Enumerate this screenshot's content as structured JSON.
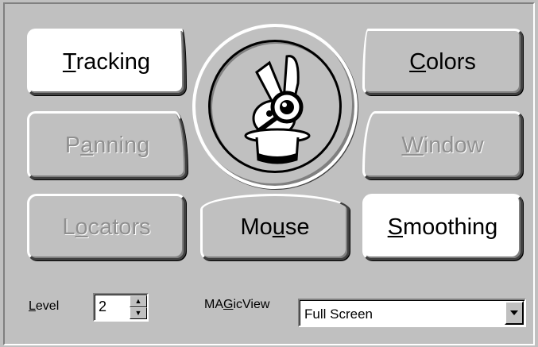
{
  "buttons": {
    "tracking": {
      "pre": "",
      "key": "T",
      "post": "racking"
    },
    "colors": {
      "pre": "",
      "key": "C",
      "post": "olors"
    },
    "panning": {
      "pre": "P",
      "key": "a",
      "post": "nning"
    },
    "window": {
      "pre": "",
      "key": "W",
      "post": "indow"
    },
    "locators": {
      "pre": "L",
      "key": "o",
      "post": "cators"
    },
    "mouse": {
      "pre": "Mo",
      "key": "u",
      "post": "se"
    },
    "smoothing": {
      "pre": "",
      "key": "S",
      "post": "moothing"
    }
  },
  "level": {
    "pre": "",
    "key": "L",
    "post": "evel",
    "value": "2"
  },
  "magicview": {
    "pre": "MA",
    "key": "G",
    "post": "icView",
    "value": "Full Screen"
  },
  "icons": {
    "logo": "rabbit-magnifier-top-hat-icon",
    "spin_up": "arrow-up-icon",
    "spin_down": "arrow-down-icon",
    "dropdown": "triangle-down-icon"
  },
  "colors": {
    "face": "#c0c0c0",
    "active": "#ffffff",
    "disabled_text": "#909090"
  }
}
